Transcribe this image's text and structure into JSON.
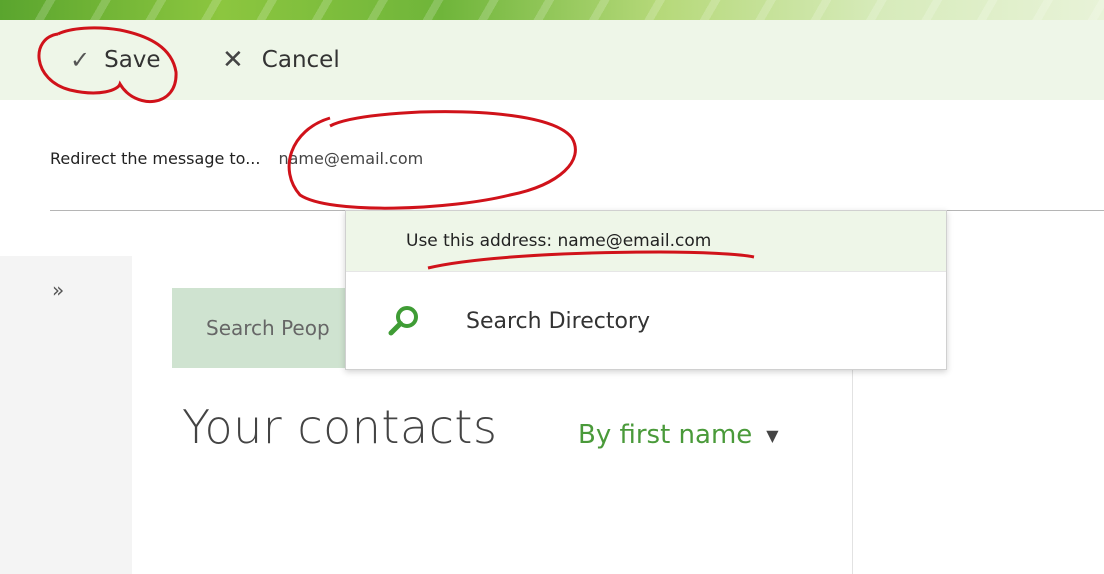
{
  "toolbar": {
    "save_label": "Save",
    "cancel_label": "Cancel"
  },
  "redirect": {
    "label": "Redirect the message to...",
    "input_value": "name@email.com"
  },
  "suggestions": {
    "use_address": "Use this address: name@email.com",
    "search_directory": "Search Directory"
  },
  "people": {
    "search_placeholder": "Search Peop",
    "contacts_title": "Your contacts",
    "sort_label": "By first name"
  },
  "icons": {
    "save": "check-icon",
    "cancel": "close-icon",
    "expand": "double-chevron-right-icon",
    "search": "search-icon",
    "dropdown": "caret-down-icon"
  },
  "colors": {
    "accent_green": "#4a9a3a",
    "toolbar_bg": "#eef6e8",
    "annotation_red": "#d0121a"
  }
}
